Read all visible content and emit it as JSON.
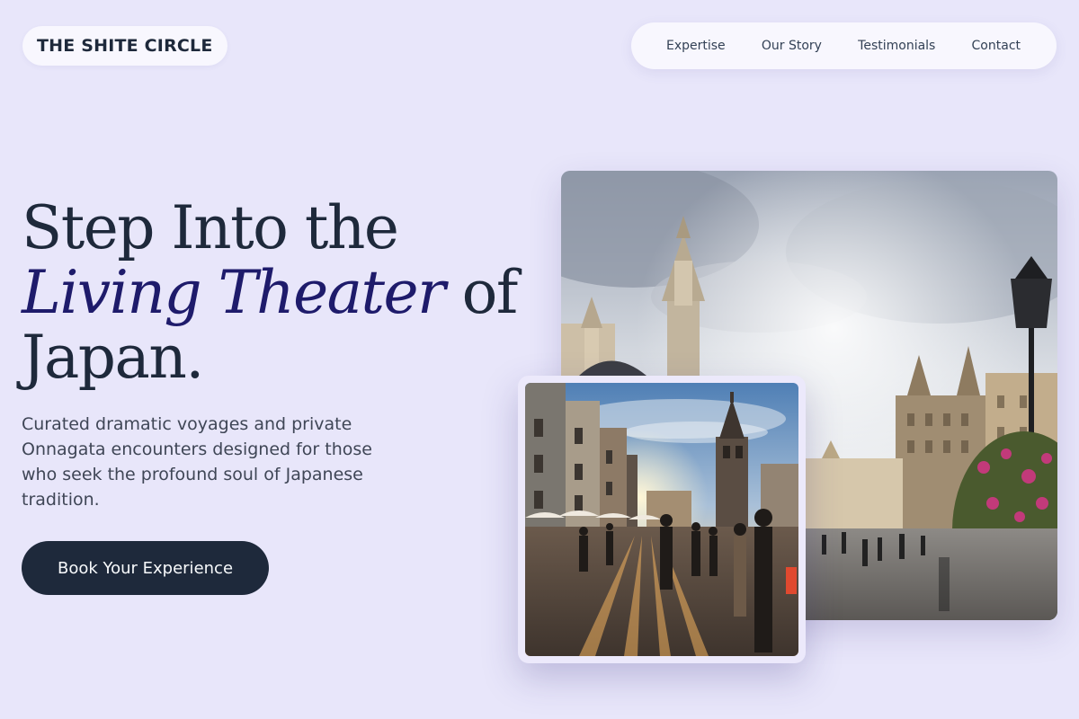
{
  "brand": {
    "name": "THE SHITE CIRCLE"
  },
  "nav": {
    "items": [
      {
        "label": "Expertise"
      },
      {
        "label": "Our Story"
      },
      {
        "label": "Testimonials"
      },
      {
        "label": "Contact"
      }
    ]
  },
  "hero": {
    "title_line1": "Step Into the",
    "title_italic": "Living Theater",
    "title_of": " of",
    "title_line3": "Japan.",
    "subtitle": "Curated dramatic voyages and private Onnagata encounters designed for those who seek the profound soul of Japanese tradition.",
    "cta_label": "Book Your Experience"
  },
  "images": {
    "large": {
      "subject": "grand-place-gothic-square-photo"
    },
    "small": {
      "subject": "old-town-square-sunset-photo"
    }
  },
  "colors": {
    "background": "#e8e6fa",
    "surface": "#f8f7fe",
    "ink": "#1e293b",
    "accent_italic": "#1e1b6b",
    "button": "#1e293b"
  }
}
